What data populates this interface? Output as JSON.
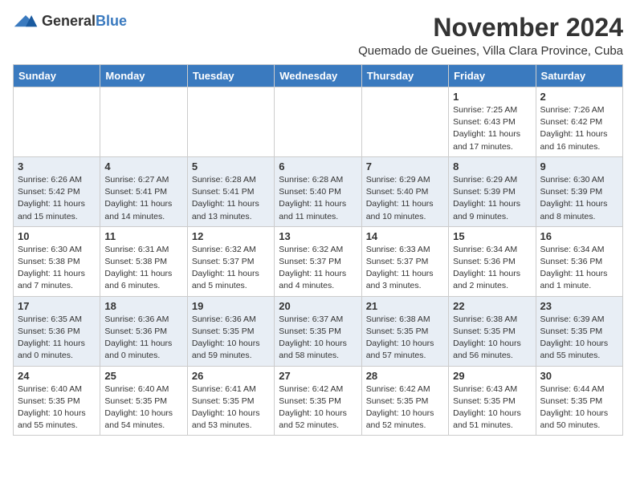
{
  "header": {
    "logo_general": "General",
    "logo_blue": "Blue",
    "month_title": "November 2024",
    "subtitle": "Quemado de Gueines, Villa Clara Province, Cuba"
  },
  "calendar": {
    "days_of_week": [
      "Sunday",
      "Monday",
      "Tuesday",
      "Wednesday",
      "Thursday",
      "Friday",
      "Saturday"
    ],
    "weeks": [
      [
        {
          "day": "",
          "info": ""
        },
        {
          "day": "",
          "info": ""
        },
        {
          "day": "",
          "info": ""
        },
        {
          "day": "",
          "info": ""
        },
        {
          "day": "",
          "info": ""
        },
        {
          "day": "1",
          "info": "Sunrise: 7:25 AM\nSunset: 6:43 PM\nDaylight: 11 hours and 17 minutes."
        },
        {
          "day": "2",
          "info": "Sunrise: 7:26 AM\nSunset: 6:42 PM\nDaylight: 11 hours and 16 minutes."
        }
      ],
      [
        {
          "day": "3",
          "info": "Sunrise: 6:26 AM\nSunset: 5:42 PM\nDaylight: 11 hours and 15 minutes."
        },
        {
          "day": "4",
          "info": "Sunrise: 6:27 AM\nSunset: 5:41 PM\nDaylight: 11 hours and 14 minutes."
        },
        {
          "day": "5",
          "info": "Sunrise: 6:28 AM\nSunset: 5:41 PM\nDaylight: 11 hours and 13 minutes."
        },
        {
          "day": "6",
          "info": "Sunrise: 6:28 AM\nSunset: 5:40 PM\nDaylight: 11 hours and 11 minutes."
        },
        {
          "day": "7",
          "info": "Sunrise: 6:29 AM\nSunset: 5:40 PM\nDaylight: 11 hours and 10 minutes."
        },
        {
          "day": "8",
          "info": "Sunrise: 6:29 AM\nSunset: 5:39 PM\nDaylight: 11 hours and 9 minutes."
        },
        {
          "day": "9",
          "info": "Sunrise: 6:30 AM\nSunset: 5:39 PM\nDaylight: 11 hours and 8 minutes."
        }
      ],
      [
        {
          "day": "10",
          "info": "Sunrise: 6:30 AM\nSunset: 5:38 PM\nDaylight: 11 hours and 7 minutes."
        },
        {
          "day": "11",
          "info": "Sunrise: 6:31 AM\nSunset: 5:38 PM\nDaylight: 11 hours and 6 minutes."
        },
        {
          "day": "12",
          "info": "Sunrise: 6:32 AM\nSunset: 5:37 PM\nDaylight: 11 hours and 5 minutes."
        },
        {
          "day": "13",
          "info": "Sunrise: 6:32 AM\nSunset: 5:37 PM\nDaylight: 11 hours and 4 minutes."
        },
        {
          "day": "14",
          "info": "Sunrise: 6:33 AM\nSunset: 5:37 PM\nDaylight: 11 hours and 3 minutes."
        },
        {
          "day": "15",
          "info": "Sunrise: 6:34 AM\nSunset: 5:36 PM\nDaylight: 11 hours and 2 minutes."
        },
        {
          "day": "16",
          "info": "Sunrise: 6:34 AM\nSunset: 5:36 PM\nDaylight: 11 hours and 1 minute."
        }
      ],
      [
        {
          "day": "17",
          "info": "Sunrise: 6:35 AM\nSunset: 5:36 PM\nDaylight: 11 hours and 0 minutes."
        },
        {
          "day": "18",
          "info": "Sunrise: 6:36 AM\nSunset: 5:36 PM\nDaylight: 11 hours and 0 minutes."
        },
        {
          "day": "19",
          "info": "Sunrise: 6:36 AM\nSunset: 5:35 PM\nDaylight: 10 hours and 59 minutes."
        },
        {
          "day": "20",
          "info": "Sunrise: 6:37 AM\nSunset: 5:35 PM\nDaylight: 10 hours and 58 minutes."
        },
        {
          "day": "21",
          "info": "Sunrise: 6:38 AM\nSunset: 5:35 PM\nDaylight: 10 hours and 57 minutes."
        },
        {
          "day": "22",
          "info": "Sunrise: 6:38 AM\nSunset: 5:35 PM\nDaylight: 10 hours and 56 minutes."
        },
        {
          "day": "23",
          "info": "Sunrise: 6:39 AM\nSunset: 5:35 PM\nDaylight: 10 hours and 55 minutes."
        }
      ],
      [
        {
          "day": "24",
          "info": "Sunrise: 6:40 AM\nSunset: 5:35 PM\nDaylight: 10 hours and 55 minutes."
        },
        {
          "day": "25",
          "info": "Sunrise: 6:40 AM\nSunset: 5:35 PM\nDaylight: 10 hours and 54 minutes."
        },
        {
          "day": "26",
          "info": "Sunrise: 6:41 AM\nSunset: 5:35 PM\nDaylight: 10 hours and 53 minutes."
        },
        {
          "day": "27",
          "info": "Sunrise: 6:42 AM\nSunset: 5:35 PM\nDaylight: 10 hours and 52 minutes."
        },
        {
          "day": "28",
          "info": "Sunrise: 6:42 AM\nSunset: 5:35 PM\nDaylight: 10 hours and 52 minutes."
        },
        {
          "day": "29",
          "info": "Sunrise: 6:43 AM\nSunset: 5:35 PM\nDaylight: 10 hours and 51 minutes."
        },
        {
          "day": "30",
          "info": "Sunrise: 6:44 AM\nSunset: 5:35 PM\nDaylight: 10 hours and 50 minutes."
        }
      ]
    ]
  }
}
